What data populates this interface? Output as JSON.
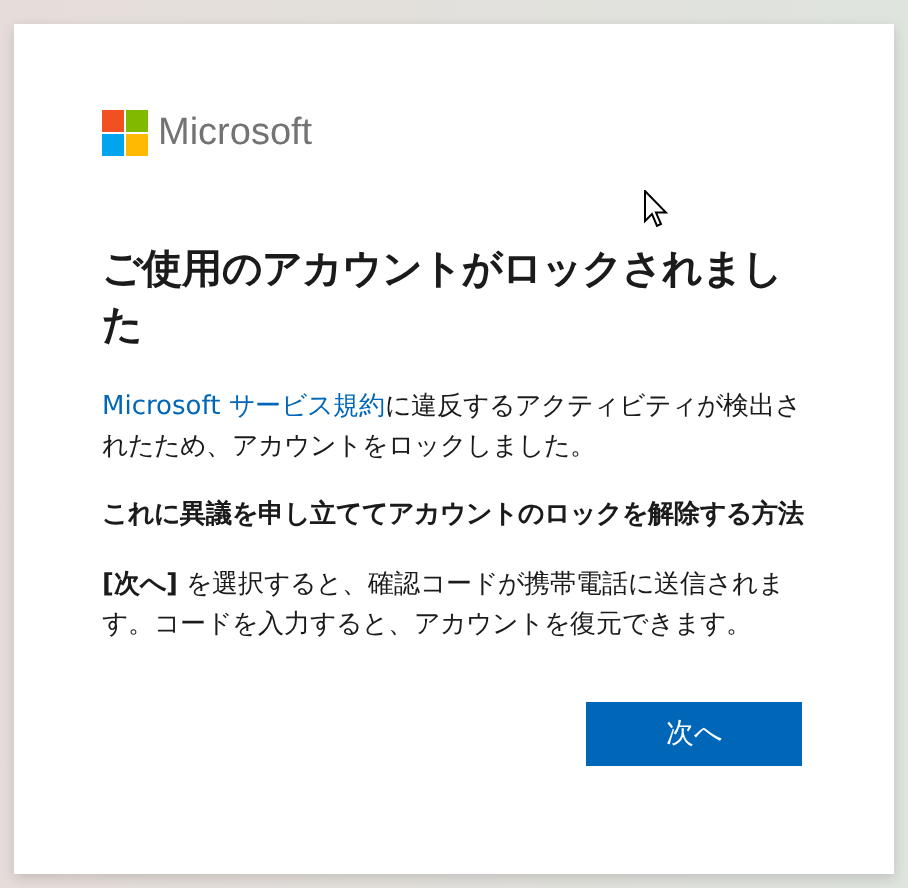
{
  "brand": {
    "name": "Microsoft"
  },
  "heading": "ご使用のアカウントがロックされました",
  "notice": {
    "link": "Microsoft サービス規約",
    "text": "に違反するアクティビティが検出されたため、アカウントをロックしました。"
  },
  "subheading": "これに異議を申し立ててアカウントのロックを解除する方法",
  "instructions": "**[次へ]** を選択すると、確認コードが携帯電話に送信されます。コードを入力すると、アカウントを復元できます。",
  "buttons": [
    {
      "label": "次へ",
      "kind": "primary"
    }
  ]
}
